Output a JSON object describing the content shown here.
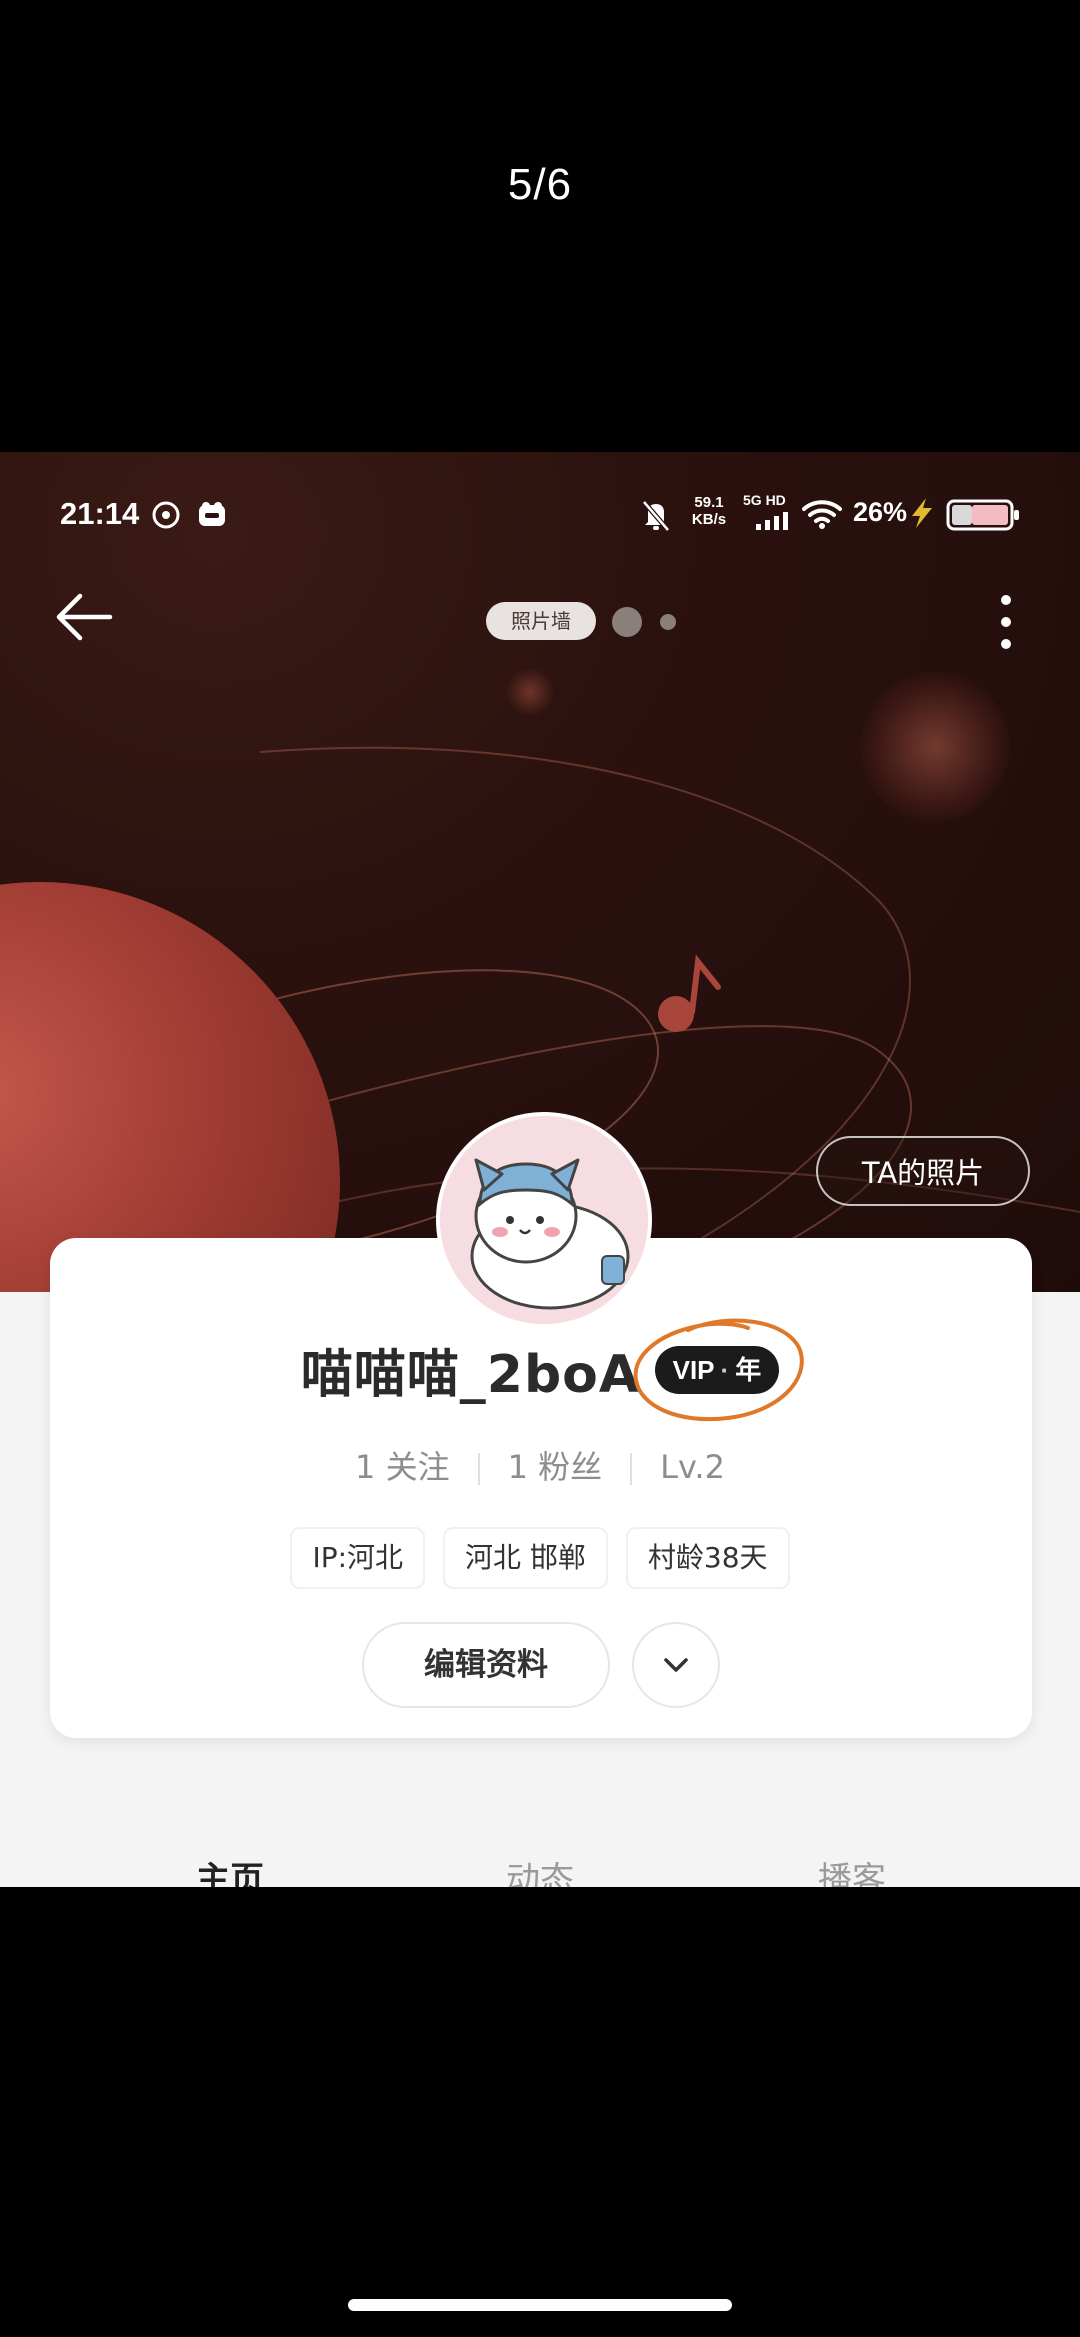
{
  "viewer": {
    "counter": "5/6"
  },
  "statusbar": {
    "time": "21:14",
    "net_speed_value": "59.1",
    "net_speed_unit": "KB/s",
    "network": "5G HD",
    "battery": "26%"
  },
  "topbar": {
    "photo_wall_label": "照片墙"
  },
  "hero": {
    "ta_photos_label": "TA的照片"
  },
  "profile": {
    "username": "喵喵喵_2boA",
    "vip_badge": {
      "brand": "VIP",
      "separator": "·",
      "term": "年"
    },
    "stats": [
      {
        "label": "1 关注"
      },
      {
        "label": "1 粉丝"
      },
      {
        "label": "Lv.2"
      }
    ],
    "tags": [
      "IP:河北",
      "河北 邯郸",
      "村龄38天"
    ],
    "edit_button": "编辑资料"
  },
  "tabs": [
    {
      "label": "主页",
      "active": true
    },
    {
      "label": "动态",
      "active": false
    },
    {
      "label": "播客",
      "active": false
    }
  ],
  "colors": {
    "hero_bg": "#1f0c0a",
    "planet": "#b14a3f",
    "vip_badge_bg": "#1b1b1b",
    "annotation_circle": "#e0782a"
  }
}
